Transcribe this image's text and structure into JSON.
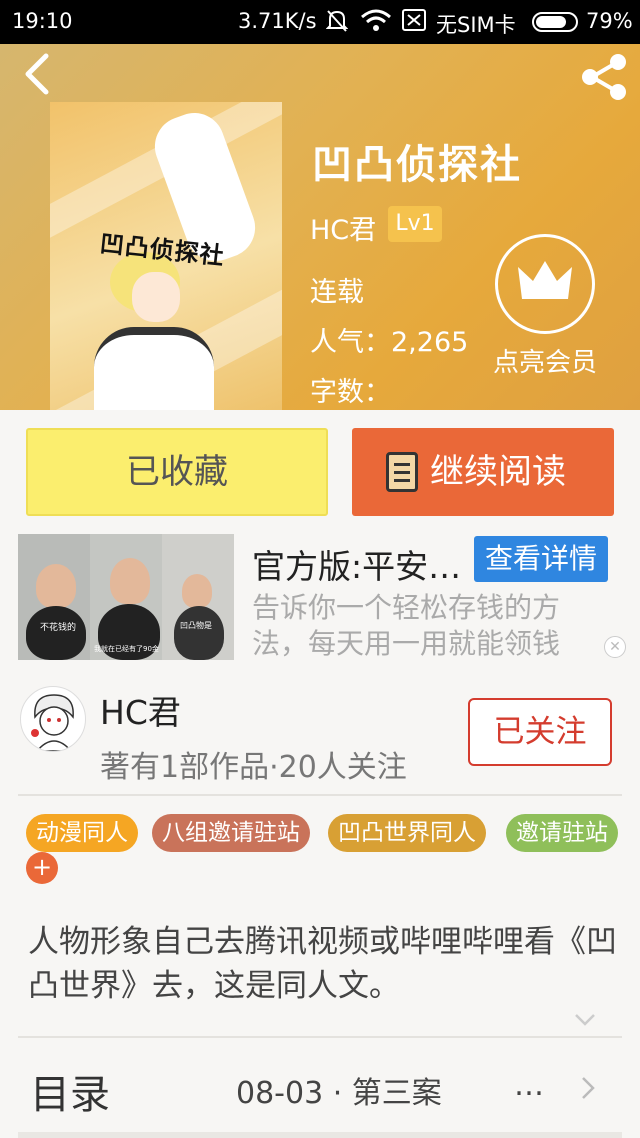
{
  "status_bar": {
    "time": "19:10",
    "speed": "3.71K/s",
    "sim": "无SIM卡",
    "battery_pct": "79%",
    "battery_level": 0.79
  },
  "book": {
    "title": "凹凸侦探社",
    "cover_text": "凹凸侦探社",
    "author": "HC君",
    "level": "Lv1",
    "status": "连载",
    "popularity": "人气：2,265",
    "words": "字数："
  },
  "vip": {
    "label": "点亮会员"
  },
  "actions": {
    "favorited_label": "已收藏",
    "continue_label": "继续阅读"
  },
  "ad": {
    "title": "官方版:平安…",
    "detail_button": "查看详情",
    "description": "告诉你一个轻松存钱的方法，每天用一用就能领钱",
    "close": "✕",
    "caption1": "不花钱的",
    "caption2": "我就在已经有了90金",
    "caption3": "凹凸物是"
  },
  "author_card": {
    "name": "HC君",
    "meta": "著有1部作品·20人关注",
    "follow_label": "已关注"
  },
  "tags": [
    {
      "label": "动漫同人",
      "color": "#f5a623"
    },
    {
      "label": "八组邀请驻站",
      "color": "#c9735a"
    },
    {
      "label": "凹凸世界同人",
      "color": "#d8a034"
    },
    {
      "label": "邀请驻站",
      "color": "#8fbf5a"
    }
  ],
  "tag_add": "+",
  "intro": "人物形象自己去腾讯视频或哔哩哔哩看《凹凸世界》去，这是同人文。",
  "toc": {
    "label": "目录",
    "latest": "08-03 · 第三案",
    "more": "…"
  }
}
